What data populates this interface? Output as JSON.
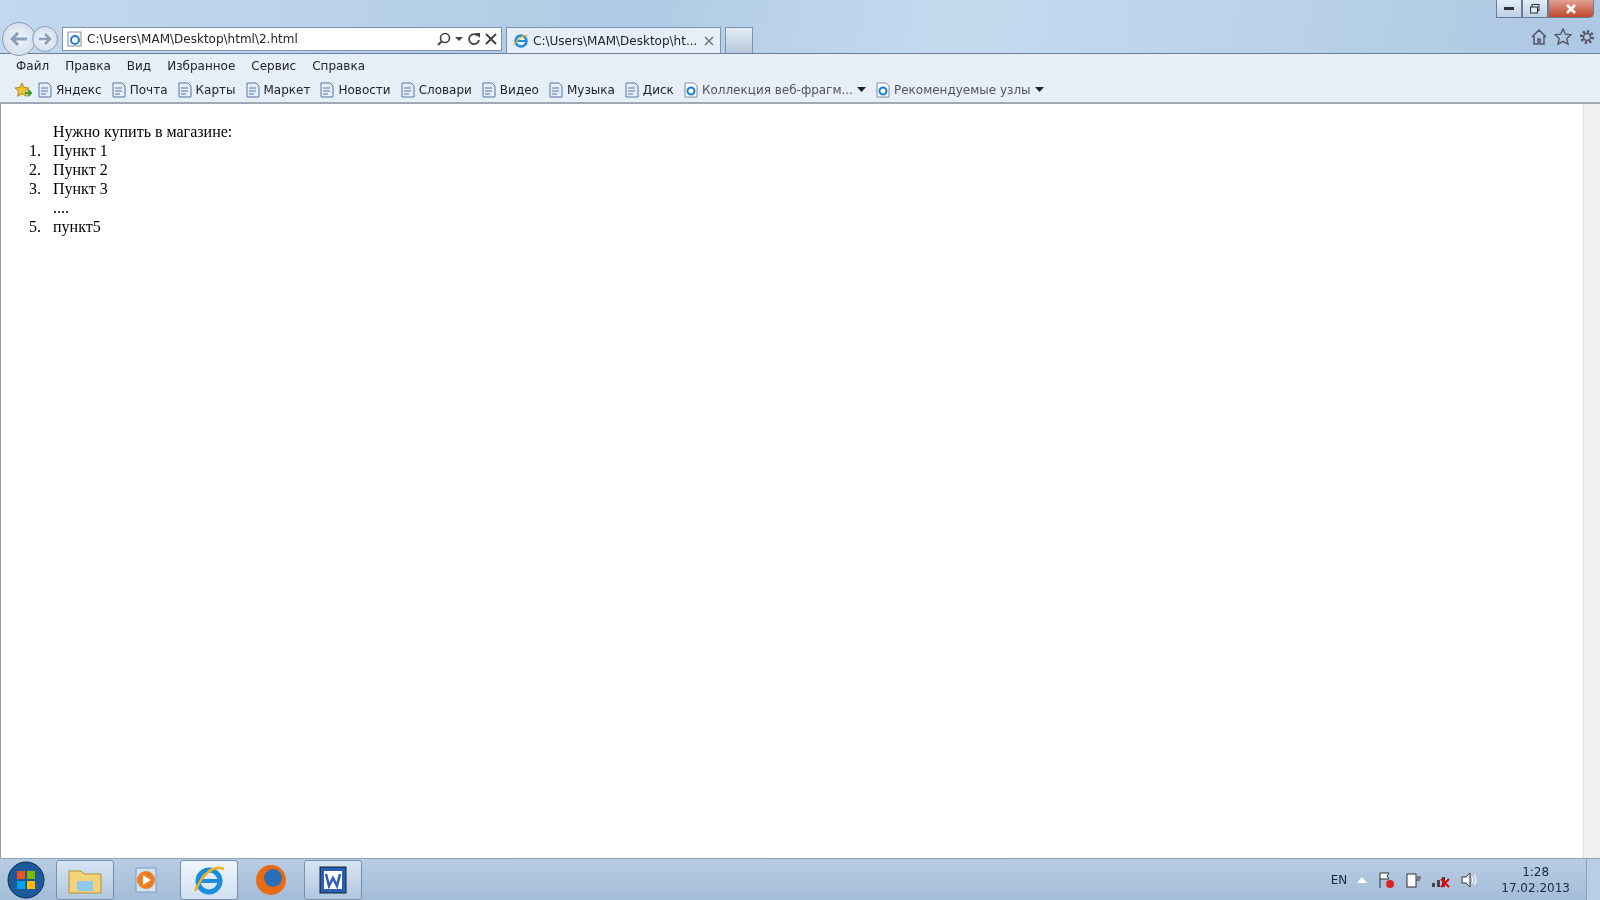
{
  "address_bar": {
    "url": "C:\\Users\\MAM\\Desktop\\html\\2.html"
  },
  "tabs": [
    {
      "label": "C:\\Users\\MAM\\Desktop\\ht...",
      "selected": true
    }
  ],
  "menu": [
    "Файл",
    "Правка",
    "Вид",
    "Избранное",
    "Сервис",
    "Справка"
  ],
  "favorites": [
    {
      "label": "Яндекс",
      "kind": "link"
    },
    {
      "label": "Почта",
      "kind": "link"
    },
    {
      "label": "Карты",
      "kind": "link"
    },
    {
      "label": "Маркет",
      "kind": "link"
    },
    {
      "label": "Новости",
      "kind": "link"
    },
    {
      "label": "Словари",
      "kind": "link"
    },
    {
      "label": "Видео",
      "kind": "link"
    },
    {
      "label": "Музыка",
      "kind": "link"
    },
    {
      "label": "Диск",
      "kind": "link"
    },
    {
      "label": "Коллекция веб-фрагм...",
      "kind": "dropdown"
    },
    {
      "label": "Рекомендуемые узлы",
      "kind": "dropdown"
    }
  ],
  "page": {
    "heading": "Нужно купить в магазине:",
    "items": [
      {
        "number": "1.",
        "text": "Пункт 1"
      },
      {
        "number": "2.",
        "text": "Пункт 2"
      },
      {
        "number": "3.",
        "text": "Пункт 3"
      },
      {
        "text": "...."
      },
      {
        "number": "5.",
        "text": "пункт5"
      }
    ]
  },
  "taskbar": {
    "apps": [
      {
        "kind": "folder",
        "running": true,
        "selected": false
      },
      {
        "kind": "media",
        "running": false,
        "selected": false
      },
      {
        "kind": "browser",
        "running": true,
        "selected": true
      },
      {
        "kind": "fox",
        "running": false,
        "selected": false
      },
      {
        "kind": "document",
        "running": true,
        "selected": false
      }
    ],
    "language": "EN",
    "time": "1:28",
    "date": "17.02.2013"
  }
}
